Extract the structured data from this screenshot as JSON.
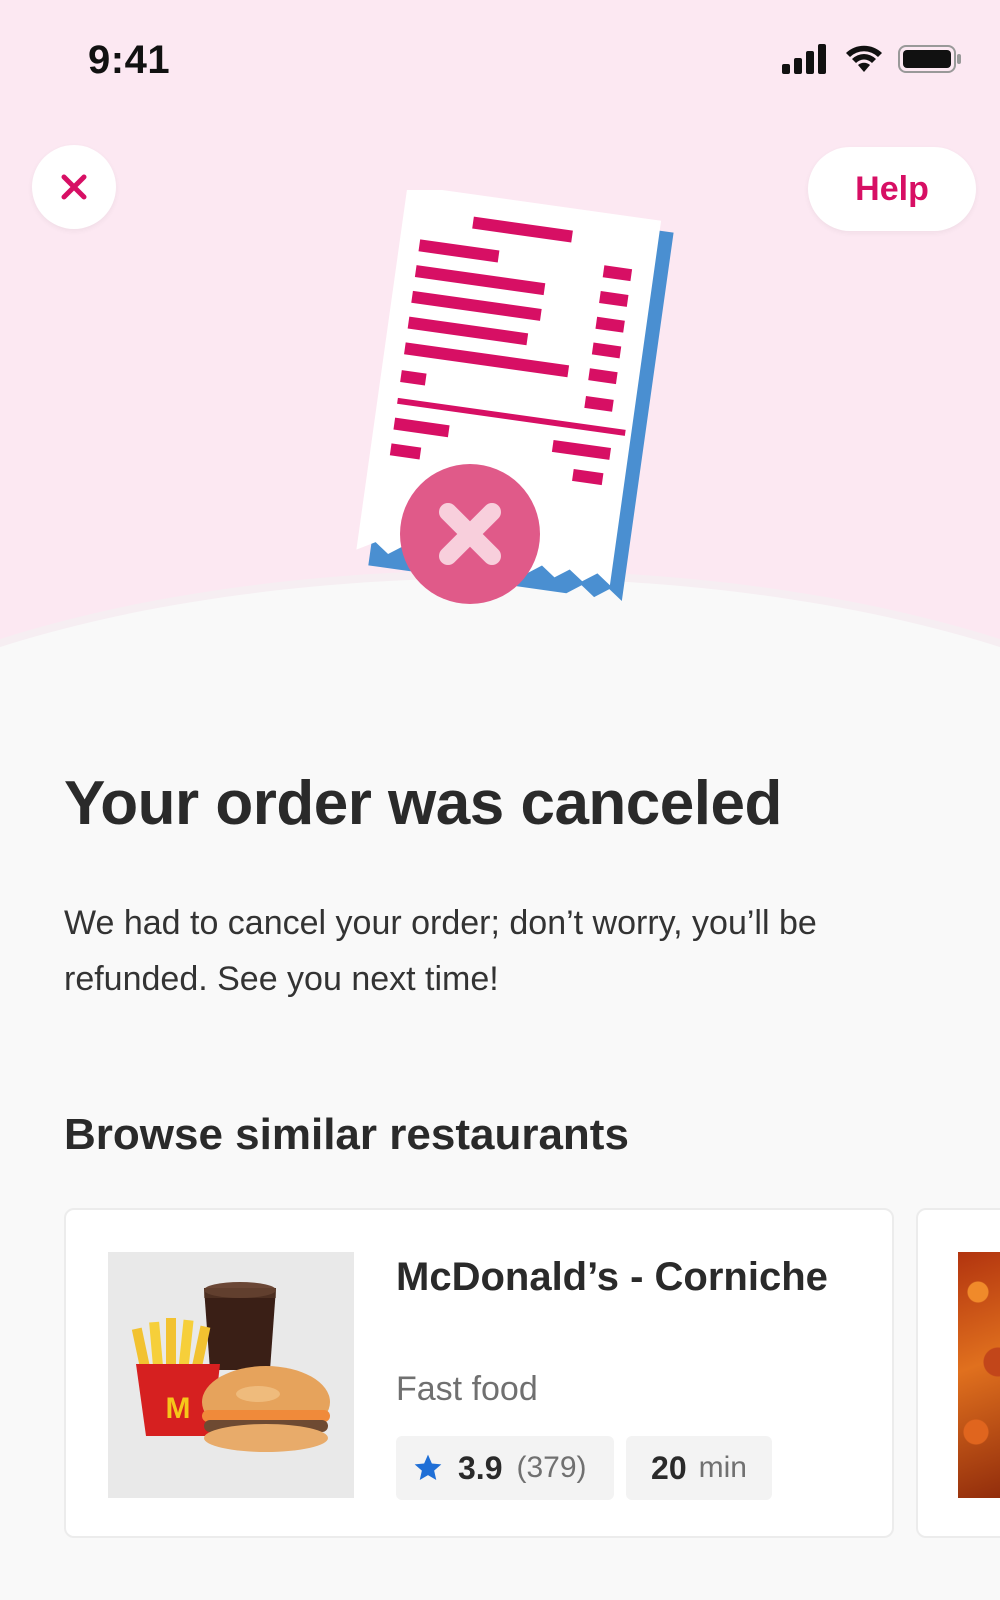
{
  "status_bar": {
    "time": "9:41"
  },
  "header": {
    "help_label": "Help"
  },
  "main": {
    "title": "Your order was canceled",
    "message": "We had to cancel your order; don’t worry, you’ll be refunded. See you next time!"
  },
  "similar": {
    "section_title": "Browse similar restaurants",
    "restaurants": [
      {
        "name": "McDonald’s - Corniche",
        "cuisine": "Fast food",
        "rating": "3.9",
        "rating_count": "(379)",
        "delivery_time": "20",
        "delivery_unit": "min"
      }
    ]
  },
  "colors": {
    "brand": "#d70f64",
    "hero_background": "#fce8f2",
    "star": "#1f6fd6"
  },
  "icons": {
    "close": "close-icon",
    "star": "star-icon",
    "signal": "signal-icon",
    "wifi": "wifi-icon",
    "battery": "battery-icon"
  }
}
